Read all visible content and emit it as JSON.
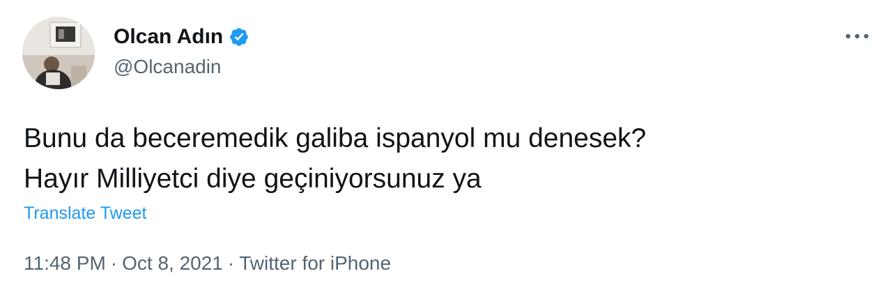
{
  "author": {
    "display_name": "Olcan Adın",
    "handle": "@Olcanadin",
    "verified": true,
    "verified_color": "#1d9bf0"
  },
  "tweet": {
    "lines": [
      "Bunu da beceremedik galiba ispanyol mu denesek?",
      "Hayır Milliyetci diye geçiniyorsunuz ya"
    ],
    "translate_label": "Translate Tweet",
    "time": "11:48 PM",
    "date": "Oct 8, 2021",
    "source": "Twitter for iPhone",
    "separator": "·"
  },
  "icons": {
    "more": "more-horizontal-icon",
    "verified": "verified-badge-icon"
  },
  "colors": {
    "text_primary": "#0f1419",
    "text_secondary": "#536471",
    "link": "#1d9bf0"
  }
}
